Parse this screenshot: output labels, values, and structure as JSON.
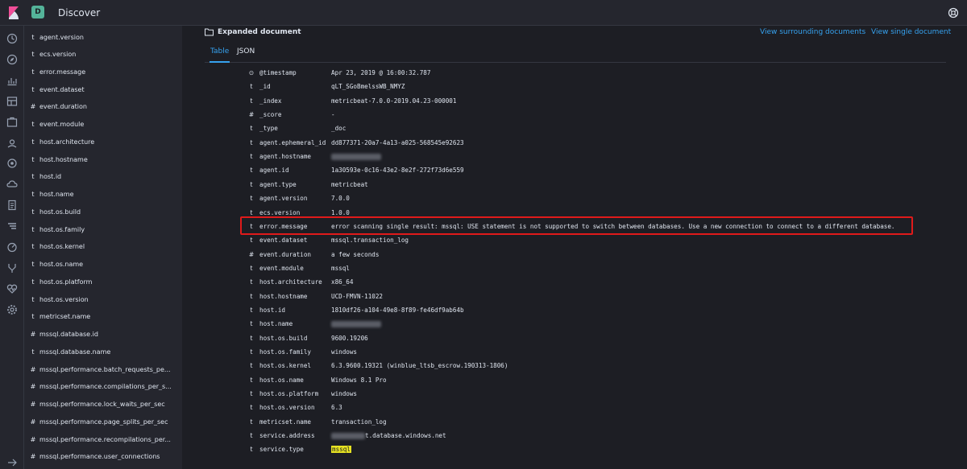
{
  "header": {
    "app_badge": "D",
    "title": "Discover"
  },
  "rail": {
    "icons": [
      "clock-icon",
      "compass-icon",
      "chart-icon",
      "dashboard-icon",
      "canvas-icon",
      "maps-icon",
      "ml-icon",
      "infrastructure-icon",
      "logs-icon",
      "apm-icon",
      "uptime-icon",
      "dev-tools-icon",
      "monitoring-icon",
      "management-icon"
    ]
  },
  "sidebar": {
    "items": [
      {
        "type": "t",
        "label": "agent.version"
      },
      {
        "type": "t",
        "label": "ecs.version"
      },
      {
        "type": "t",
        "label": "error.message"
      },
      {
        "type": "t",
        "label": "event.dataset"
      },
      {
        "type": "#",
        "label": "event.duration"
      },
      {
        "type": "t",
        "label": "event.module"
      },
      {
        "type": "t",
        "label": "host.architecture"
      },
      {
        "type": "t",
        "label": "host.hostname"
      },
      {
        "type": "t",
        "label": "host.id"
      },
      {
        "type": "t",
        "label": "host.name"
      },
      {
        "type": "t",
        "label": "host.os.build"
      },
      {
        "type": "t",
        "label": "host.os.family"
      },
      {
        "type": "t",
        "label": "host.os.kernel"
      },
      {
        "type": "t",
        "label": "host.os.name"
      },
      {
        "type": "t",
        "label": "host.os.platform"
      },
      {
        "type": "t",
        "label": "host.os.version"
      },
      {
        "type": "t",
        "label": "metricset.name"
      },
      {
        "type": "#",
        "label": "mssql.database.id"
      },
      {
        "type": "t",
        "label": "mssql.database.name"
      },
      {
        "type": "#",
        "label": "mssql.performance.batch_requests_pe..."
      },
      {
        "type": "#",
        "label": "mssql.performance.compilations_per_s..."
      },
      {
        "type": "#",
        "label": "mssql.performance.lock_waits_per_sec"
      },
      {
        "type": "#",
        "label": "mssql.performance.page_splits_per_sec"
      },
      {
        "type": "#",
        "label": "mssql.performance.recompilations_per..."
      },
      {
        "type": "#",
        "label": "mssql.performance.user_connections"
      }
    ]
  },
  "document": {
    "heading": "Expanded document",
    "link_surrounding": "View surrounding documents",
    "link_single": "View single document",
    "tabs": [
      {
        "label": "Table"
      },
      {
        "label": "JSON"
      }
    ],
    "rows": [
      {
        "type": "⊙",
        "key": "@timestamp",
        "value": "Apr 23, 2019 @ 16:00:32.787"
      },
      {
        "type": "t",
        "key": "_id",
        "value": "qLT_SGoBmelssWB_NMYZ"
      },
      {
        "type": "t",
        "key": "_index",
        "value": "metricbeat-7.0.0-2019.04.23-000001"
      },
      {
        "type": "#",
        "key": "_score",
        "value": " -"
      },
      {
        "type": "t",
        "key": "_type",
        "value": "_doc"
      },
      {
        "type": "t",
        "key": "agent.ephemeral_id",
        "value": "dd877371-20a7-4a13-a025-568545e92623"
      },
      {
        "type": "t",
        "key": "agent.hostname",
        "value": "",
        "redacted": true
      },
      {
        "type": "t",
        "key": "agent.id",
        "value": "1a30593e-0c16-43e2-8e2f-272f73d6e559"
      },
      {
        "type": "t",
        "key": "agent.type",
        "value": "metricbeat"
      },
      {
        "type": "t",
        "key": "agent.version",
        "value": "7.0.0"
      },
      {
        "type": "t",
        "key": "ecs.version",
        "value": "1.0.0"
      },
      {
        "type": "t",
        "key": "error.message",
        "value": "error scanning single result: mssql: USE statement is not supported to switch between databases. Use a new connection to connect to a different database."
      },
      {
        "type": "t",
        "key": "event.dataset",
        "value": "mssql.transaction_log"
      },
      {
        "type": "#",
        "key": "event.duration",
        "value": "a few seconds"
      },
      {
        "type": "t",
        "key": "event.module",
        "value": "mssql"
      },
      {
        "type": "t",
        "key": "host.architecture",
        "value": "x86_64"
      },
      {
        "type": "t",
        "key": "host.hostname",
        "value": "UCD-FMVN-11022"
      },
      {
        "type": "t",
        "key": "host.id",
        "value": "1810df26-a104-49e8-8f89-fe46df9ab64b"
      },
      {
        "type": "t",
        "key": "host.name",
        "value": "",
        "redacted": true
      },
      {
        "type": "t",
        "key": "host.os.build",
        "value": "9600.19206"
      },
      {
        "type": "t",
        "key": "host.os.family",
        "value": "windows"
      },
      {
        "type": "t",
        "key": "host.os.kernel",
        "value": "6.3.9600.19321 (winblue_ltsb_escrow.190313-1806)"
      },
      {
        "type": "t",
        "key": "host.os.name",
        "value": "Windows 8.1 Pro"
      },
      {
        "type": "t",
        "key": "host.os.platform",
        "value": "windows"
      },
      {
        "type": "t",
        "key": "host.os.version",
        "value": "6.3"
      },
      {
        "type": "t",
        "key": "metricset.name",
        "value": "transaction_log"
      },
      {
        "type": "t",
        "key": "service.address",
        "value": "t.database.windows.net",
        "redacted_prefix": true
      },
      {
        "type": "t",
        "key": "service.type",
        "value": "mssql",
        "highlighted": true
      }
    ]
  },
  "colors": {
    "accent": "#36a2ef",
    "highlight_box": "#e01a1a",
    "search_highlight": "#e7e322"
  }
}
